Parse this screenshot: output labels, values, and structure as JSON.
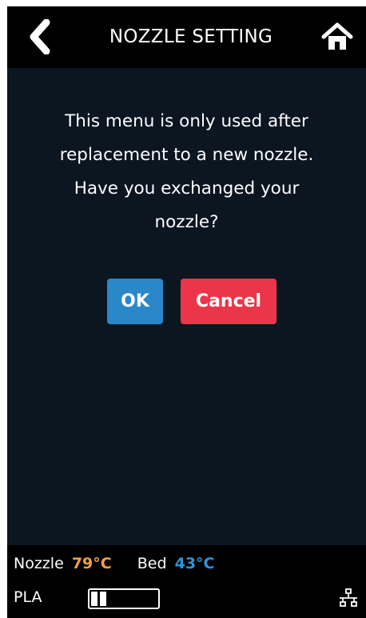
{
  "header": {
    "title": "NOZZLE SETTING",
    "back_icon": "chevron-left-icon",
    "home_icon": "home-icon"
  },
  "dialog": {
    "message_lines": [
      "This menu is only used after",
      "replacement to a new nozzle.",
      "Have you exchanged your",
      "nozzle?"
    ],
    "ok_label": "OK",
    "cancel_label": "Cancel"
  },
  "status": {
    "nozzle_label": "Nozzle",
    "nozzle_temp": "79°C",
    "bed_label": "Bed",
    "bed_temp": "43°C",
    "material": "PLA",
    "filament_level": 0.2,
    "network_icon": "network-icon"
  },
  "colors": {
    "content_bg": "#0c1621",
    "ok_button": "#2a87c8",
    "cancel_button": "#ec3548",
    "nozzle_temp": "#f0a04c",
    "bed_temp": "#2f93d6"
  }
}
